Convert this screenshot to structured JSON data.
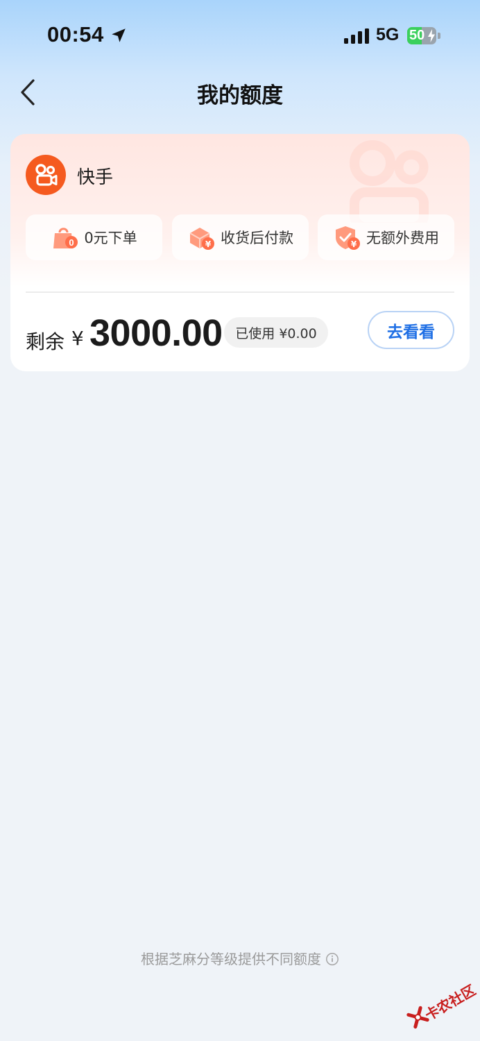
{
  "status_bar": {
    "time": "00:54",
    "network": "5G",
    "battery_percent": "50",
    "battery_level": 0.5
  },
  "nav": {
    "back_icon": "chevron-left-icon",
    "title": "我的额度"
  },
  "card": {
    "brand": {
      "name": "快手",
      "logo_icon": "kuaishou-logo-icon",
      "logo_color": "#f55a1f"
    },
    "features": [
      {
        "label": "0元下单",
        "icon": "shopping-bag-icon"
      },
      {
        "label": "收货后付款",
        "icon": "package-yuan-icon"
      },
      {
        "label": "无额外费用",
        "icon": "shield-yuan-icon"
      }
    ],
    "remaining_label": "剩余",
    "currency_symbol": "¥",
    "amount": "3000.00",
    "used_text": "已使用 ¥0.00",
    "view_button_label": "去看看",
    "accent_color": "#1f6fe5"
  },
  "footer": {
    "note": "根据芝麻分等级提供不同额度",
    "info_icon": "info-circle-icon"
  },
  "watermark": {
    "text": "卡农社区"
  }
}
